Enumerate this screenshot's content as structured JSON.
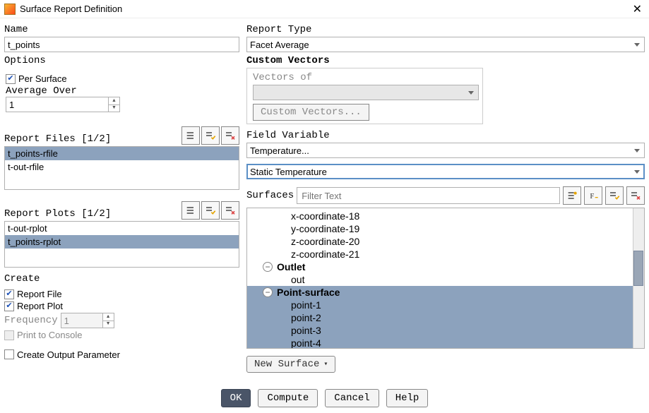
{
  "window": {
    "title": "Surface Report Definition"
  },
  "left": {
    "name_label": "Name",
    "name_value": "t_points",
    "options_label": "Options",
    "per_surface_label": "Per Surface",
    "average_over_label": "Average Over",
    "average_over_value": "1",
    "report_files_label": "Report Files [1/2]",
    "report_files_items": [
      "t_points-rfile",
      "t-out-rfile"
    ],
    "report_files_selected": 0,
    "report_plots_label": "Report Plots [1/2]",
    "report_plots_items": [
      "t-out-rplot",
      "t_points-rplot"
    ],
    "report_plots_selected": 1,
    "create_label": "Create",
    "report_file_label": "Report File",
    "report_plot_label": "Report Plot",
    "frequency_label": "Frequency",
    "frequency_value": "1",
    "print_to_console_label": "Print to Console",
    "create_output_param_label": "Create Output Parameter"
  },
  "right": {
    "report_type_label": "Report Type",
    "report_type_value": "Facet Average",
    "custom_vectors_label": "Custom Vectors",
    "vectors_of_label": "Vectors of",
    "vectors_of_value": "",
    "custom_vectors_btn": "Custom Vectors...",
    "field_variable_label": "Field Variable",
    "field_variable_1": "Temperature...",
    "field_variable_2": "Static Temperature",
    "surfaces_label": "Surfaces",
    "surfaces_placeholder": "Filter Text",
    "tree": {
      "plain": [
        "x-coordinate-18",
        "y-coordinate-19",
        "z-coordinate-20",
        "z-coordinate-21"
      ],
      "groups": [
        {
          "name": "Outlet",
          "children": [
            "out"
          ],
          "selected": false
        },
        {
          "name": "Point-surface",
          "children": [
            "point-1",
            "point-2",
            "point-3",
            "point-4"
          ],
          "selected": true
        }
      ]
    },
    "new_surface_btn": "New Surface"
  },
  "footer": {
    "ok": "OK",
    "compute": "Compute",
    "cancel": "Cancel",
    "help": "Help"
  }
}
